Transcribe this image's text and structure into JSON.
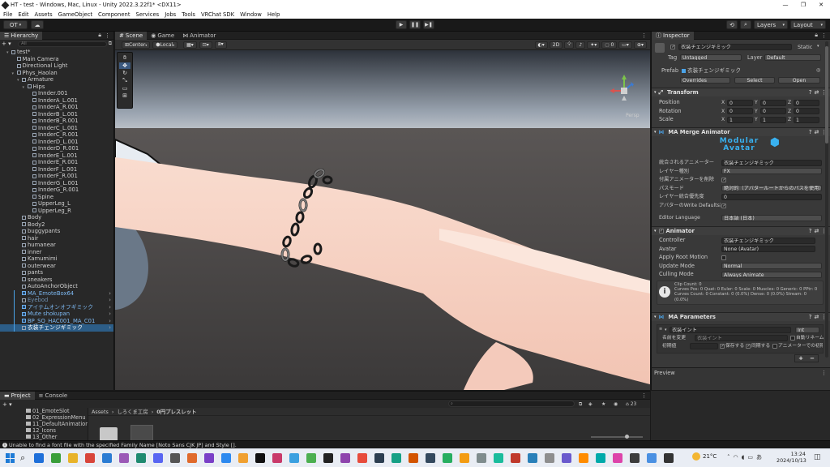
{
  "window": {
    "title": "HT - test - Windows, Mac, Linux - Unity 2022.3.22f1* <DX11>",
    "controls": [
      "—",
      "❐",
      "✕"
    ]
  },
  "menu": [
    "File",
    "Edit",
    "Assets",
    "GameObject",
    "Component",
    "Services",
    "Jobs",
    "Tools",
    "VRChat SDK",
    "Window",
    "Help"
  ],
  "toolbar": {
    "account": "OT",
    "layers": "Layers",
    "layout": "Layout"
  },
  "hierarchy": {
    "tab": "Hierarchy",
    "search_placeholder": "All",
    "items": [
      {
        "label": "test*",
        "depth": 0,
        "kind": "scene"
      },
      {
        "label": "Main Camera",
        "depth": 1
      },
      {
        "label": "Directional Light",
        "depth": 1
      },
      {
        "label": "Phys_Haolan",
        "depth": 1,
        "expanded": true
      },
      {
        "label": "Armature",
        "depth": 2,
        "expanded": true
      },
      {
        "label": "Hips",
        "depth": 3,
        "expanded": true
      },
      {
        "label": "Innder.001",
        "depth": 4
      },
      {
        "label": "InnderA_L.001",
        "depth": 4
      },
      {
        "label": "InnderA_R.001",
        "depth": 4
      },
      {
        "label": "InnderB_L.001",
        "depth": 4
      },
      {
        "label": "InnderB_R.001",
        "depth": 4
      },
      {
        "label": "InnderC_L.001",
        "depth": 4
      },
      {
        "label": "InnderC_R.001",
        "depth": 4
      },
      {
        "label": "InnderD_L.001",
        "depth": 4
      },
      {
        "label": "InnderD_R.001",
        "depth": 4
      },
      {
        "label": "InnderE_L.001",
        "depth": 4
      },
      {
        "label": "InnderE_R.001",
        "depth": 4
      },
      {
        "label": "InnderF_L.001",
        "depth": 4
      },
      {
        "label": "InnderF_R.001",
        "depth": 4
      },
      {
        "label": "InnderG_L.001",
        "depth": 4
      },
      {
        "label": "InnderG_R.001",
        "depth": 4
      },
      {
        "label": "Spine",
        "depth": 4
      },
      {
        "label": "UpperLeg_L",
        "depth": 4
      },
      {
        "label": "UpperLeg_R",
        "depth": 4
      },
      {
        "label": "Body",
        "depth": 2
      },
      {
        "label": "Body2",
        "depth": 2
      },
      {
        "label": "buggypants",
        "depth": 2
      },
      {
        "label": "hair",
        "depth": 2
      },
      {
        "label": "humanear",
        "depth": 2
      },
      {
        "label": "inner",
        "depth": 2
      },
      {
        "label": "Kamumimi",
        "depth": 2
      },
      {
        "label": "outerwear",
        "depth": 2
      },
      {
        "label": "pants",
        "depth": 2
      },
      {
        "label": "sneakers",
        "depth": 2
      },
      {
        "label": "AutoAnchorObject",
        "depth": 2
      },
      {
        "label": "MA_EmoteBox64",
        "depth": 2,
        "style": "blue"
      },
      {
        "label": "Eyebod",
        "depth": 2,
        "style": "dim"
      },
      {
        "label": "アイテムオンオフギミック",
        "depth": 2,
        "style": "blue"
      },
      {
        "label": "Mute shokupan",
        "depth": 2,
        "style": "blue"
      },
      {
        "label": "BP_SQ_HAC001_MA_C01",
        "depth": 2,
        "style": "blue"
      },
      {
        "label": "衣装チェンジギミック",
        "depth": 2,
        "style": "selected"
      }
    ]
  },
  "scene": {
    "tabs": [
      "Scene",
      "Game",
      "Animator"
    ],
    "pivot": "Center",
    "space": "Local",
    "mode_2d": "2D",
    "view_label": "Persp"
  },
  "inspector": {
    "tab": "Inspector",
    "object_name": "衣装チェンジギミック",
    "static_label": "Static",
    "tag_label": "Tag",
    "tag_value": "Untagged",
    "layer_label": "Layer",
    "layer_value": "Default",
    "prefab_label": "Prefab",
    "prefab_value": "衣装チェンジギミック",
    "overrides": "Overrides",
    "select": "Select",
    "open": "Open",
    "transform": {
      "title": "Transform",
      "rows": [
        {
          "label": "Position",
          "x": "0",
          "y": "0",
          "z": "0"
        },
        {
          "label": "Rotation",
          "x": "0",
          "y": "0",
          "z": "0"
        },
        {
          "label": "Scale",
          "x": "1",
          "y": "1",
          "z": "1"
        }
      ]
    },
    "merge_animator": {
      "title": "MA Merge Animator",
      "logo_line1": "Modular",
      "logo_line2": "Avatar",
      "rows": [
        {
          "label": "統合されるアニメーター",
          "value": "衣装チェンジギミック"
        },
        {
          "label": "レイヤー種別",
          "value": "FX"
        },
        {
          "label": "付属アニメーターを削除",
          "value": ""
        },
        {
          "label": "パスモード",
          "value": "絶対的（アバタールートからのパスを使用）"
        },
        {
          "label": "レイヤー統合優先度",
          "value": "0"
        },
        {
          "label": "アバターのWrite Defaults設定に",
          "value": ""
        },
        {
          "label": "Editor Language",
          "value": "日本語 (日本)"
        }
      ]
    },
    "animator": {
      "title": "Animator",
      "rows": [
        {
          "label": "Controller",
          "value": "衣装チェンジギミック"
        },
        {
          "label": "Avatar",
          "value": "None (Avatar)"
        },
        {
          "label": "Apply Root Motion",
          "value": ""
        },
        {
          "label": "Update Mode",
          "value": "Normal"
        },
        {
          "label": "Culling Mode",
          "value": "Always Animate"
        }
      ],
      "info": [
        "Clip Count: 0",
        "Curves Pos: 0 Quat: 0 Euler: 0 Scale: 0 Muscles: 0 Generic: 0 PPtr: 0",
        "Curves Count: 0 Constant: 0 (0.0%) Dense: 0 (0.0%) Stream: 0",
        "(0.0%)"
      ]
    },
    "parameters": {
      "title": "MA Parameters",
      "param_name": "衣装イント",
      "param_type": "Int",
      "rename_label": "名前を変更",
      "rename_placeholder": "衣装イント",
      "auto_rename": "自動リネーム",
      "default_label": "初期値",
      "saved": "保存する",
      "synced": "同期する",
      "anim_default": "アニメーターでの初期値"
    },
    "preview": "Preview"
  },
  "project": {
    "tabs": [
      "Project",
      "Console"
    ],
    "folders": [
      "01_EmoteSlot",
      "02_ExpressionMenu",
      "11_DefaultAnimation",
      "12_Icons",
      "13_Other"
    ],
    "breadcrumb": [
      "Assets",
      "しろくま工房",
      "0円プレスレット"
    ],
    "count": "23"
  },
  "status": {
    "message": "Unable to find a font file with the specified Family Name [Noto Sans CJK JP] and Style []."
  },
  "taskbar": {
    "weather": "21°C",
    "time": "13:24",
    "date": "2024/10/13",
    "colors": [
      "#1e6fd9",
      "#3a9e3a",
      "#e8b32a",
      "#d8453a",
      "#2b7cd3",
      "#9b59b6",
      "#1f8a70",
      "#5865f2",
      "#555555",
      "#e06a2c",
      "#7a3fc7",
      "#2d89ef",
      "#f0a030",
      "#111111",
      "#c93a6a",
      "#3aa0e0",
      "#4caf50",
      "#222222",
      "#8e44ad",
      "#e74c3c",
      "#2c3e50",
      "#16a085",
      "#d35400",
      "#34495e",
      "#27ae60",
      "#f39c12",
      "#7f8c8d",
      "#1abc9c",
      "#c0392b",
      "#2980b9",
      "#8e8e8e",
      "#6a5acd",
      "#ff8c00",
      "#0aa",
      "#d4a",
      "#3c3c3c",
      "#4a90e2",
      "#333333",
      "#f5a623",
      "#e67e22",
      "#1565c0",
      "#5d5d5d",
      "#888888",
      "#444444",
      "#2e7d32",
      "#666666"
    ]
  }
}
